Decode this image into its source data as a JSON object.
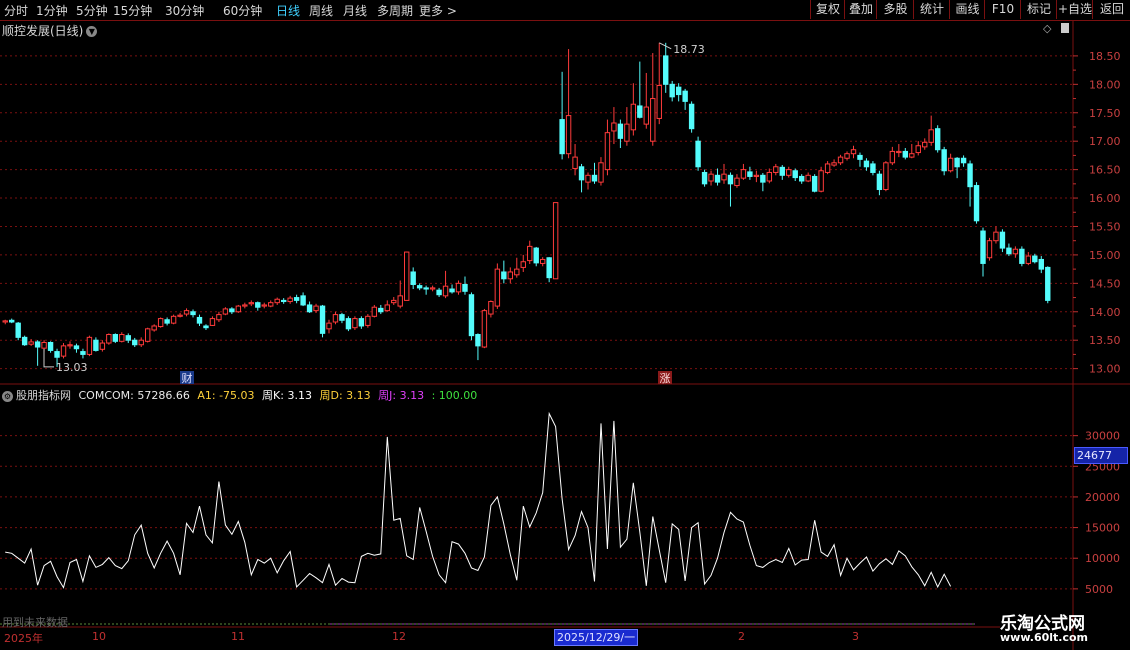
{
  "toolbar": {
    "periods": [
      "分时",
      "1分钟",
      "5分钟",
      "15分钟",
      "30分钟",
      "60分钟",
      "日线",
      "周线",
      "月线",
      "多周期",
      "更多 >"
    ],
    "active_period": "日线",
    "buttons": [
      "复权",
      "叠加",
      "多股",
      "统计",
      "画线",
      "F10",
      "标记",
      "+自选",
      "返回"
    ]
  },
  "stock": {
    "title": "顺控发展(日线)"
  },
  "price_axis": {
    "ticks": [
      "18.50",
      "18.00",
      "17.50",
      "17.00",
      "16.50",
      "16.00",
      "15.50",
      "15.00",
      "14.50",
      "14.00",
      "13.50",
      "13.00"
    ]
  },
  "annotations": {
    "high_label": "18.73",
    "low_label": "13.03",
    "marker_cai": "财",
    "marker_zhang": "涨"
  },
  "indicator": {
    "name": "股朋指标网",
    "comcom": "COMCOM: 57286.66",
    "a1": "A1: -75.03",
    "k": "周K: 3.13",
    "d": "周D: 3.13",
    "j": "周J: 3.13",
    "extra": ": 100.00",
    "axis_ticks": [
      "30000",
      "25000",
      "20000",
      "15000",
      "10000",
      "5000"
    ],
    "current_value": "24677"
  },
  "future_label": "用到未来数据",
  "x_axis": {
    "labels": [
      "2025年",
      "10",
      "11",
      "12",
      "2",
      "3"
    ],
    "cursor_date": "2025/12/29/一"
  },
  "watermark": {
    "name": "乐淘公式网",
    "url": "www.60lt.com"
  },
  "colors": {
    "up": "#ff3b3b",
    "down": "#54fcfc",
    "line": "#ffffff",
    "grid": "#7a1010",
    "active": "#3fd0ff"
  },
  "chart_data": {
    "type": "candlestick",
    "price_ylim": [
      12.8,
      18.85
    ],
    "indicator_ylim": [
      4000,
      35000
    ],
    "candles": [
      [
        13.82,
        13.84,
        13.78,
        13.86
      ],
      [
        13.85,
        13.82,
        13.8,
        13.88
      ],
      [
        13.8,
        13.55,
        13.5,
        13.82
      ],
      [
        13.55,
        13.42,
        13.4,
        13.58
      ],
      [
        13.43,
        13.47,
        13.4,
        13.52
      ],
      [
        13.47,
        13.38,
        13.05,
        13.5
      ],
      [
        13.36,
        13.46,
        13.3,
        13.5
      ],
      [
        13.46,
        13.32,
        13.28,
        13.48
      ],
      [
        13.3,
        13.2,
        13.03,
        13.35
      ],
      [
        13.22,
        13.4,
        13.18,
        13.45
      ],
      [
        13.4,
        13.42,
        13.35,
        13.48
      ],
      [
        13.4,
        13.35,
        13.28,
        13.44
      ],
      [
        13.3,
        13.25,
        13.18,
        13.35
      ],
      [
        13.25,
        13.55,
        13.22,
        13.58
      ],
      [
        13.5,
        13.32,
        13.3,
        13.55
      ],
      [
        13.34,
        13.45,
        13.3,
        13.5
      ],
      [
        13.45,
        13.6,
        13.42,
        13.62
      ],
      [
        13.6,
        13.48,
        13.45,
        13.62
      ],
      [
        13.48,
        13.6,
        13.46,
        13.64
      ],
      [
        13.58,
        13.5,
        13.45,
        13.62
      ],
      [
        13.5,
        13.42,
        13.38,
        13.54
      ],
      [
        13.42,
        13.5,
        13.38,
        13.55
      ],
      [
        13.48,
        13.7,
        13.46,
        13.72
      ],
      [
        13.68,
        13.75,
        13.65,
        13.78
      ],
      [
        13.74,
        13.88,
        13.72,
        13.9
      ],
      [
        13.86,
        13.8,
        13.76,
        13.9
      ],
      [
        13.8,
        13.92,
        13.78,
        13.95
      ],
      [
        13.92,
        13.94,
        13.9,
        13.98
      ],
      [
        13.96,
        14.02,
        13.92,
        14.06
      ],
      [
        14.0,
        13.95,
        13.9,
        14.04
      ],
      [
        13.9,
        13.8,
        13.75,
        13.95
      ],
      [
        13.75,
        13.72,
        13.68,
        13.78
      ],
      [
        13.76,
        13.88,
        13.75,
        13.92
      ],
      [
        13.86,
        13.95,
        13.82,
        14.0
      ],
      [
        13.96,
        14.05,
        13.94,
        14.08
      ],
      [
        14.05,
        14.0,
        13.96,
        14.08
      ],
      [
        14.0,
        14.1,
        13.98,
        14.12
      ],
      [
        14.1,
        14.12,
        14.06,
        14.16
      ],
      [
        14.14,
        14.16,
        14.1,
        14.2
      ],
      [
        14.16,
        14.08,
        14.02,
        14.18
      ],
      [
        14.1,
        14.12,
        14.06,
        14.16
      ],
      [
        14.1,
        14.16,
        14.08,
        14.2
      ],
      [
        14.16,
        14.22,
        14.12,
        14.25
      ],
      [
        14.2,
        14.18,
        14.14,
        14.24
      ],
      [
        14.18,
        14.24,
        14.14,
        14.28
      ],
      [
        14.25,
        14.2,
        14.15,
        14.3
      ],
      [
        14.28,
        14.12,
        14.1,
        14.34
      ],
      [
        14.12,
        14.0,
        13.98,
        14.18
      ],
      [
        14.02,
        14.1,
        13.98,
        14.14
      ],
      [
        14.1,
        13.62,
        13.55,
        14.12
      ],
      [
        13.7,
        13.8,
        13.62,
        13.86
      ],
      [
        13.82,
        13.95,
        13.78,
        14.0
      ],
      [
        13.95,
        13.85,
        13.8,
        13.98
      ],
      [
        13.88,
        13.7,
        13.66,
        13.92
      ],
      [
        13.72,
        13.88,
        13.68,
        13.92
      ],
      [
        13.88,
        13.75,
        13.7,
        13.92
      ],
      [
        13.76,
        13.92,
        13.72,
        13.96
      ],
      [
        13.92,
        14.08,
        13.9,
        14.12
      ],
      [
        14.06,
        14.0,
        13.96,
        14.12
      ],
      [
        14.02,
        14.12,
        14.0,
        14.2
      ],
      [
        14.16,
        14.2,
        14.12,
        14.26
      ],
      [
        14.1,
        14.28,
        14.06,
        14.55
      ],
      [
        14.2,
        15.05,
        14.2,
        15.06
      ],
      [
        14.7,
        14.48,
        14.4,
        14.78
      ],
      [
        14.46,
        14.42,
        14.38,
        14.5
      ],
      [
        14.42,
        14.4,
        14.3,
        14.46
      ],
      [
        14.4,
        14.42,
        14.36,
        14.46
      ],
      [
        14.38,
        14.3,
        14.26,
        14.42
      ],
      [
        14.28,
        14.45,
        14.24,
        14.72
      ],
      [
        14.4,
        14.35,
        14.32,
        14.48
      ],
      [
        14.35,
        14.5,
        14.3,
        14.55
      ],
      [
        14.48,
        14.36,
        14.3,
        14.62
      ],
      [
        14.3,
        13.58,
        13.5,
        14.34
      ],
      [
        13.6,
        13.4,
        13.15,
        13.62
      ],
      [
        13.38,
        14.02,
        13.36,
        14.05
      ],
      [
        13.96,
        14.18,
        13.9,
        14.2
      ],
      [
        14.1,
        14.75,
        14.05,
        14.85
      ],
      [
        14.7,
        14.58,
        14.5,
        14.9
      ],
      [
        14.58,
        14.7,
        14.5,
        14.78
      ],
      [
        14.65,
        14.75,
        14.6,
        14.95
      ],
      [
        14.78,
        14.88,
        14.7,
        15.0
      ],
      [
        14.9,
        15.15,
        14.84,
        15.25
      ],
      [
        15.12,
        14.86,
        14.8,
        15.14
      ],
      [
        14.85,
        14.92,
        14.8,
        14.96
      ],
      [
        14.95,
        14.6,
        14.52,
        14.96
      ],
      [
        14.58,
        15.92,
        14.58,
        15.92
      ],
      [
        17.38,
        16.78,
        16.68,
        18.22
      ],
      [
        16.78,
        17.45,
        16.7,
        18.62
      ],
      [
        16.52,
        16.72,
        16.4,
        16.95
      ],
      [
        16.55,
        16.32,
        16.1,
        16.6
      ],
      [
        16.28,
        16.4,
        16.15,
        16.45
      ],
      [
        16.4,
        16.3,
        16.25,
        16.62
      ],
      [
        16.28,
        16.62,
        16.22,
        16.72
      ],
      [
        16.5,
        17.15,
        16.4,
        17.38
      ],
      [
        17.18,
        17.32,
        16.95,
        17.6
      ],
      [
        17.3,
        17.05,
        16.88,
        17.38
      ],
      [
        17.0,
        17.3,
        16.92,
        17.6
      ],
      [
        17.2,
        17.65,
        17.1,
        18.02
      ],
      [
        17.62,
        17.42,
        17.4,
        18.4
      ],
      [
        17.3,
        17.6,
        17.22,
        18.2
      ],
      [
        17.0,
        17.75,
        16.92,
        18.55
      ],
      [
        17.4,
        17.98,
        17.3,
        18.73
      ],
      [
        18.5,
        18.0,
        17.85,
        18.73
      ],
      [
        18.0,
        17.78,
        17.7,
        18.06
      ],
      [
        17.95,
        17.82,
        17.7,
        18.02
      ],
      [
        17.88,
        17.7,
        17.55,
        17.92
      ],
      [
        17.65,
        17.22,
        17.15,
        17.7
      ],
      [
        17.0,
        16.55,
        16.48,
        17.08
      ],
      [
        16.45,
        16.25,
        16.2,
        16.5
      ],
      [
        16.3,
        16.42,
        16.22,
        16.48
      ],
      [
        16.4,
        16.28,
        16.22,
        16.52
      ],
      [
        16.32,
        16.42,
        16.25,
        16.6
      ],
      [
        16.4,
        16.25,
        15.85,
        16.45
      ],
      [
        16.22,
        16.35,
        16.18,
        16.42
      ],
      [
        16.35,
        16.5,
        16.32,
        16.6
      ],
      [
        16.46,
        16.38,
        16.32,
        16.55
      ],
      [
        16.38,
        16.4,
        16.28,
        16.48
      ],
      [
        16.4,
        16.28,
        16.12,
        16.44
      ],
      [
        16.3,
        16.45,
        16.26,
        16.52
      ],
      [
        16.45,
        16.55,
        16.4,
        16.6
      ],
      [
        16.54,
        16.4,
        16.32,
        16.58
      ],
      [
        16.4,
        16.5,
        16.36,
        16.55
      ],
      [
        16.48,
        16.36,
        16.3,
        16.52
      ],
      [
        16.38,
        16.3,
        16.25,
        16.42
      ],
      [
        16.3,
        16.4,
        16.28,
        16.45
      ],
      [
        16.38,
        16.12,
        16.1,
        16.42
      ],
      [
        16.12,
        16.48,
        16.1,
        16.55
      ],
      [
        16.45,
        16.6,
        16.42,
        16.65
      ],
      [
        16.58,
        16.62,
        16.55,
        16.68
      ],
      [
        16.62,
        16.72,
        16.58,
        16.76
      ],
      [
        16.7,
        16.78,
        16.66,
        16.82
      ],
      [
        16.78,
        16.85,
        16.7,
        16.92
      ],
      [
        16.75,
        16.68,
        16.55,
        16.8
      ],
      [
        16.65,
        16.55,
        16.48,
        16.7
      ],
      [
        16.6,
        16.45,
        16.4,
        16.65
      ],
      [
        16.42,
        16.15,
        16.05,
        16.48
      ],
      [
        16.15,
        16.62,
        16.12,
        16.65
      ],
      [
        16.62,
        16.82,
        16.58,
        16.9
      ],
      [
        16.8,
        16.82,
        16.72,
        16.95
      ],
      [
        16.82,
        16.72,
        16.68,
        16.88
      ],
      [
        16.72,
        16.78,
        16.7,
        16.95
      ],
      [
        16.8,
        16.92,
        16.75,
        17.0
      ],
      [
        16.9,
        16.98,
        16.85,
        17.05
      ],
      [
        16.98,
        17.2,
        16.92,
        17.45
      ],
      [
        17.22,
        16.85,
        16.8,
        17.28
      ],
      [
        16.85,
        16.48,
        16.4,
        16.9
      ],
      [
        16.48,
        16.7,
        16.45,
        16.78
      ],
      [
        16.7,
        16.55,
        16.35,
        16.72
      ],
      [
        16.7,
        16.62,
        16.55,
        16.75
      ],
      [
        16.6,
        16.2,
        15.85,
        16.66
      ],
      [
        16.22,
        15.6,
        15.55,
        16.28
      ],
      [
        15.42,
        14.85,
        14.62,
        15.48
      ],
      [
        14.95,
        15.25,
        14.9,
        15.3
      ],
      [
        15.25,
        15.4,
        15.2,
        15.5
      ],
      [
        15.4,
        15.12,
        15.05,
        15.45
      ],
      [
        15.12,
        15.02,
        14.98,
        15.2
      ],
      [
        15.02,
        15.1,
        14.95,
        15.15
      ],
      [
        15.1,
        14.85,
        14.8,
        15.15
      ],
      [
        14.85,
        14.98,
        14.82,
        15.05
      ],
      [
        14.98,
        14.88,
        14.85,
        15.02
      ],
      [
        14.92,
        14.75,
        14.68,
        14.98
      ],
      [
        14.78,
        14.2,
        14.15,
        14.8
      ]
    ],
    "indicator_values": [
      11000,
      10800,
      10000,
      9200,
      11500,
      5600,
      8800,
      9500,
      7000,
      5200,
      9300,
      9800,
      6200,
      10400,
      8500,
      9000,
      10100,
      8800,
      8300,
      9600,
      13800,
      15400,
      10800,
      8400,
      10800,
      12800,
      10800,
      7300,
      15700,
      14200,
      18500,
      13800,
      12500,
      22500,
      15400,
      13900,
      16000,
      12600,
      7300,
      9800,
      9200,
      10000,
      7600,
      9600,
      11100,
      5300,
      6400,
      7500,
      6800,
      6000,
      9000,
      5600,
      6700,
      6100,
      6000,
      10300,
      10800,
      10500,
      10700,
      29800,
      16200,
      16500,
      10400,
      9800,
      18300,
      14400,
      10300,
      7300,
      6000,
      12700,
      12300,
      10800,
      8400,
      8000,
      10200,
      18600,
      20000,
      15600,
      10600,
      6400,
      18500,
      15100,
      17400,
      20700,
      33600,
      31500,
      19700,
      11400,
      13700,
      17600,
      15000,
      6200,
      32000,
      11500,
      32400,
      11800,
      13100,
      22300,
      14300,
      5500,
      16800,
      11400,
      6000,
      15600,
      14700,
      6300,
      15000,
      15800,
      5800,
      7200,
      10000,
      14200,
      17500,
      16400,
      15900,
      12100,
      8800,
      8500,
      9300,
      9800,
      9300,
      11600,
      8900,
      9700,
      9800,
      16200,
      11000,
      10300,
      12200,
      7200,
      10000,
      8100,
      9200,
      10200,
      7900,
      9100,
      9900,
      9000,
      11200,
      10400,
      8600,
      7300,
      5500,
      7700,
      5300,
      7400,
      5400
    ]
  }
}
